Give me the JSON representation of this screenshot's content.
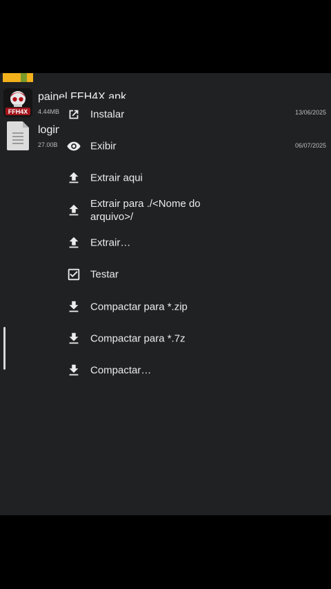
{
  "files": [
    {
      "name": "painel FFH4X.apk",
      "size": "4.44MB",
      "date": "13/06/2025",
      "thumb_text": "FFH4X"
    },
    {
      "name": "login",
      "size": "27.00B",
      "date": "06/07/2025"
    }
  ],
  "context_menu": {
    "items": [
      {
        "label": "Instalar",
        "icon": "open-external-icon"
      },
      {
        "label": "Exibir",
        "icon": "eye-icon"
      },
      {
        "label": "Extrair aqui",
        "icon": "upload-arrow-icon"
      },
      {
        "label": "Extrair para ./<Nome do arquivo>/",
        "icon": "upload-arrow-icon"
      },
      {
        "label": "Extrair…",
        "icon": "upload-arrow-icon"
      },
      {
        "label": "Testar",
        "icon": "checkbox-checked-icon"
      },
      {
        "label": "Compactar para *.zip",
        "icon": "download-arrow-icon"
      },
      {
        "label": "Compactar para *.7z",
        "icon": "download-arrow-icon"
      },
      {
        "label": "Compactar…",
        "icon": "download-arrow-icon"
      }
    ]
  },
  "colors": {
    "background": "#000000",
    "panel": "#202123",
    "text": "#ececec",
    "accent_strip": "#f3b21b"
  }
}
